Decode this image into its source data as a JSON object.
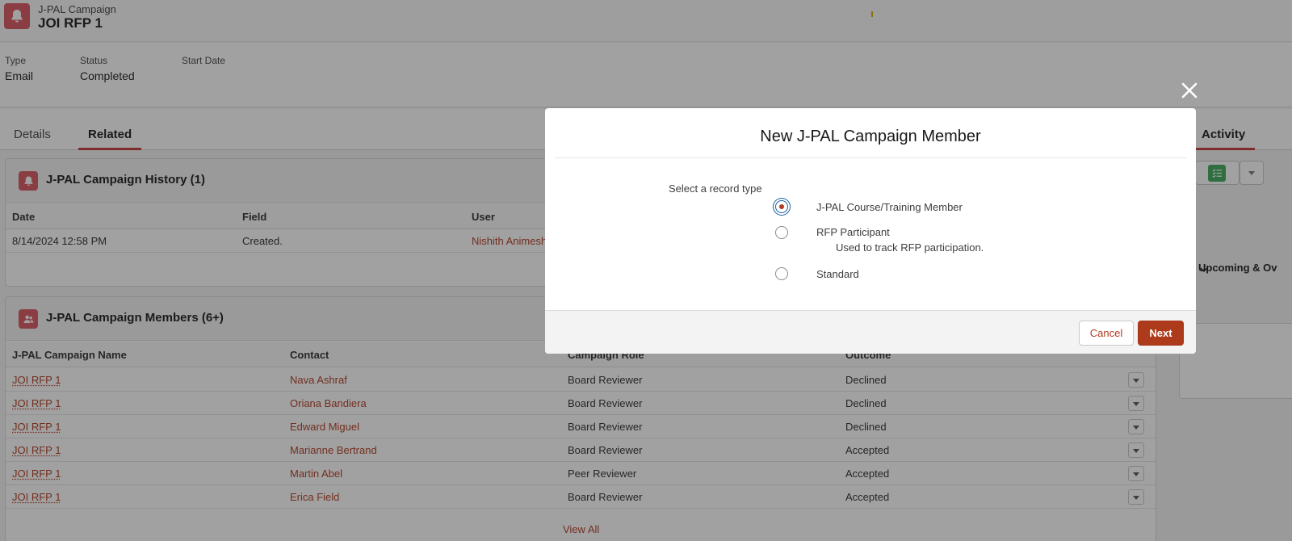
{
  "record": {
    "object_type": "J-PAL Campaign",
    "title": "JOI RFP 1"
  },
  "highlights": [
    {
      "label": "Type",
      "value": "Email"
    },
    {
      "label": "Status",
      "value": "Completed"
    },
    {
      "label": "Start Date",
      "value": ""
    }
  ],
  "tabs": {
    "details": "Details",
    "related": "Related",
    "activity": "Activity"
  },
  "history": {
    "title": "J-PAL Campaign History (1)",
    "columns": [
      "Date",
      "Field",
      "User"
    ],
    "rows": [
      {
        "date": "8/14/2024 12:58 PM",
        "field": "Created.",
        "user": "Nishith Animesh"
      }
    ]
  },
  "members": {
    "title": "J-PAL Campaign Members (6+)",
    "columns": [
      "J-PAL Campaign Name",
      "Contact",
      "Campaign Role",
      "Outcome"
    ],
    "rows": [
      {
        "campaign": "JOI RFP 1",
        "contact": "Nava Ashraf",
        "role": "Board Reviewer",
        "outcome": "Declined"
      },
      {
        "campaign": "JOI RFP 1",
        "contact": "Oriana Bandiera",
        "role": "Board Reviewer",
        "outcome": "Declined"
      },
      {
        "campaign": "JOI RFP 1",
        "contact": "Edward Miguel",
        "role": "Board Reviewer",
        "outcome": "Declined"
      },
      {
        "campaign": "JOI RFP 1",
        "contact": "Marianne Bertrand",
        "role": "Board Reviewer",
        "outcome": "Accepted"
      },
      {
        "campaign": "JOI RFP 1",
        "contact": "Martin Abel",
        "role": "Peer Reviewer",
        "outcome": "Accepted"
      },
      {
        "campaign": "JOI RFP 1",
        "contact": "Erica Field",
        "role": "Board Reviewer",
        "outcome": "Accepted"
      }
    ],
    "view_all": "View All"
  },
  "activity_panel": {
    "upcoming": "Upcoming & Ov"
  },
  "modal": {
    "title": "New J-PAL Campaign Member",
    "prompt": "Select a record type",
    "options": [
      {
        "label": "J-PAL Course/Training Member",
        "description": "",
        "selected": true
      },
      {
        "label": "RFP Participant",
        "description": "Used to track RFP participation.",
        "selected": false
      },
      {
        "label": "Standard",
        "description": "",
        "selected": false
      }
    ],
    "cancel": "Cancel",
    "next": "Next"
  },
  "colors": {
    "brand_red": "#d8545d",
    "link": "#b03a1f",
    "primary_button": "#ad3a1b",
    "activity_green": "#3ba755"
  }
}
